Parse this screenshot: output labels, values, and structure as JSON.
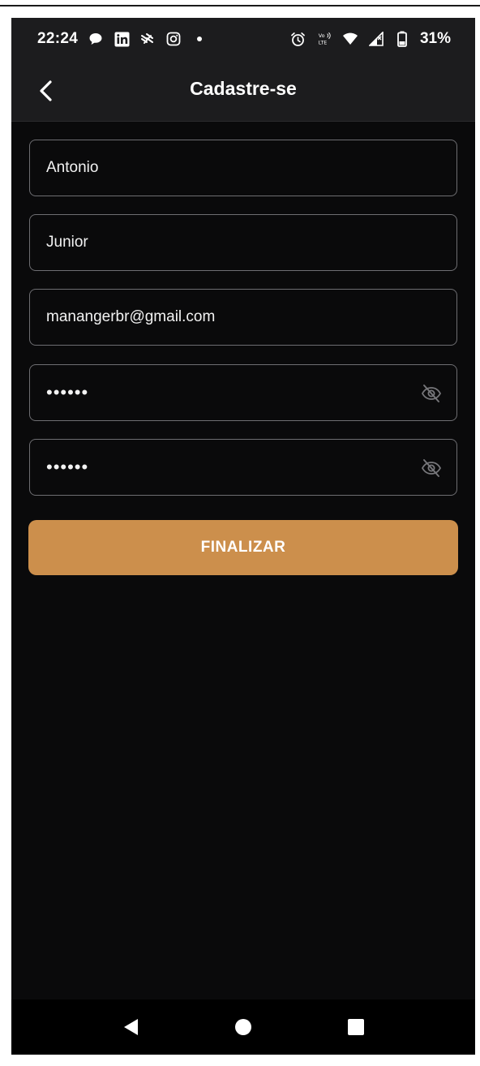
{
  "status_bar": {
    "time": "22:24",
    "battery": "31%",
    "left_icons": [
      "chat-bubble-icon",
      "linkedin-icon",
      "app-icon",
      "instagram-icon",
      "dot-icon"
    ],
    "right_icons": [
      "alarm-icon",
      "volte-icon",
      "wifi-icon",
      "signal-icon",
      "battery-icon"
    ]
  },
  "header": {
    "title": "Cadastre-se"
  },
  "form": {
    "first_name": {
      "value": "Antonio"
    },
    "last_name": {
      "value": "Junior"
    },
    "email": {
      "value": "manangerbr@gmail.com"
    },
    "password": {
      "value": "••••••"
    },
    "confirm_password": {
      "value": "••••••"
    },
    "submit_label": "FINALIZAR"
  },
  "colors": {
    "accent": "#cc8f4c",
    "background": "#0a0a0b",
    "bar": "#1c1c1e"
  }
}
